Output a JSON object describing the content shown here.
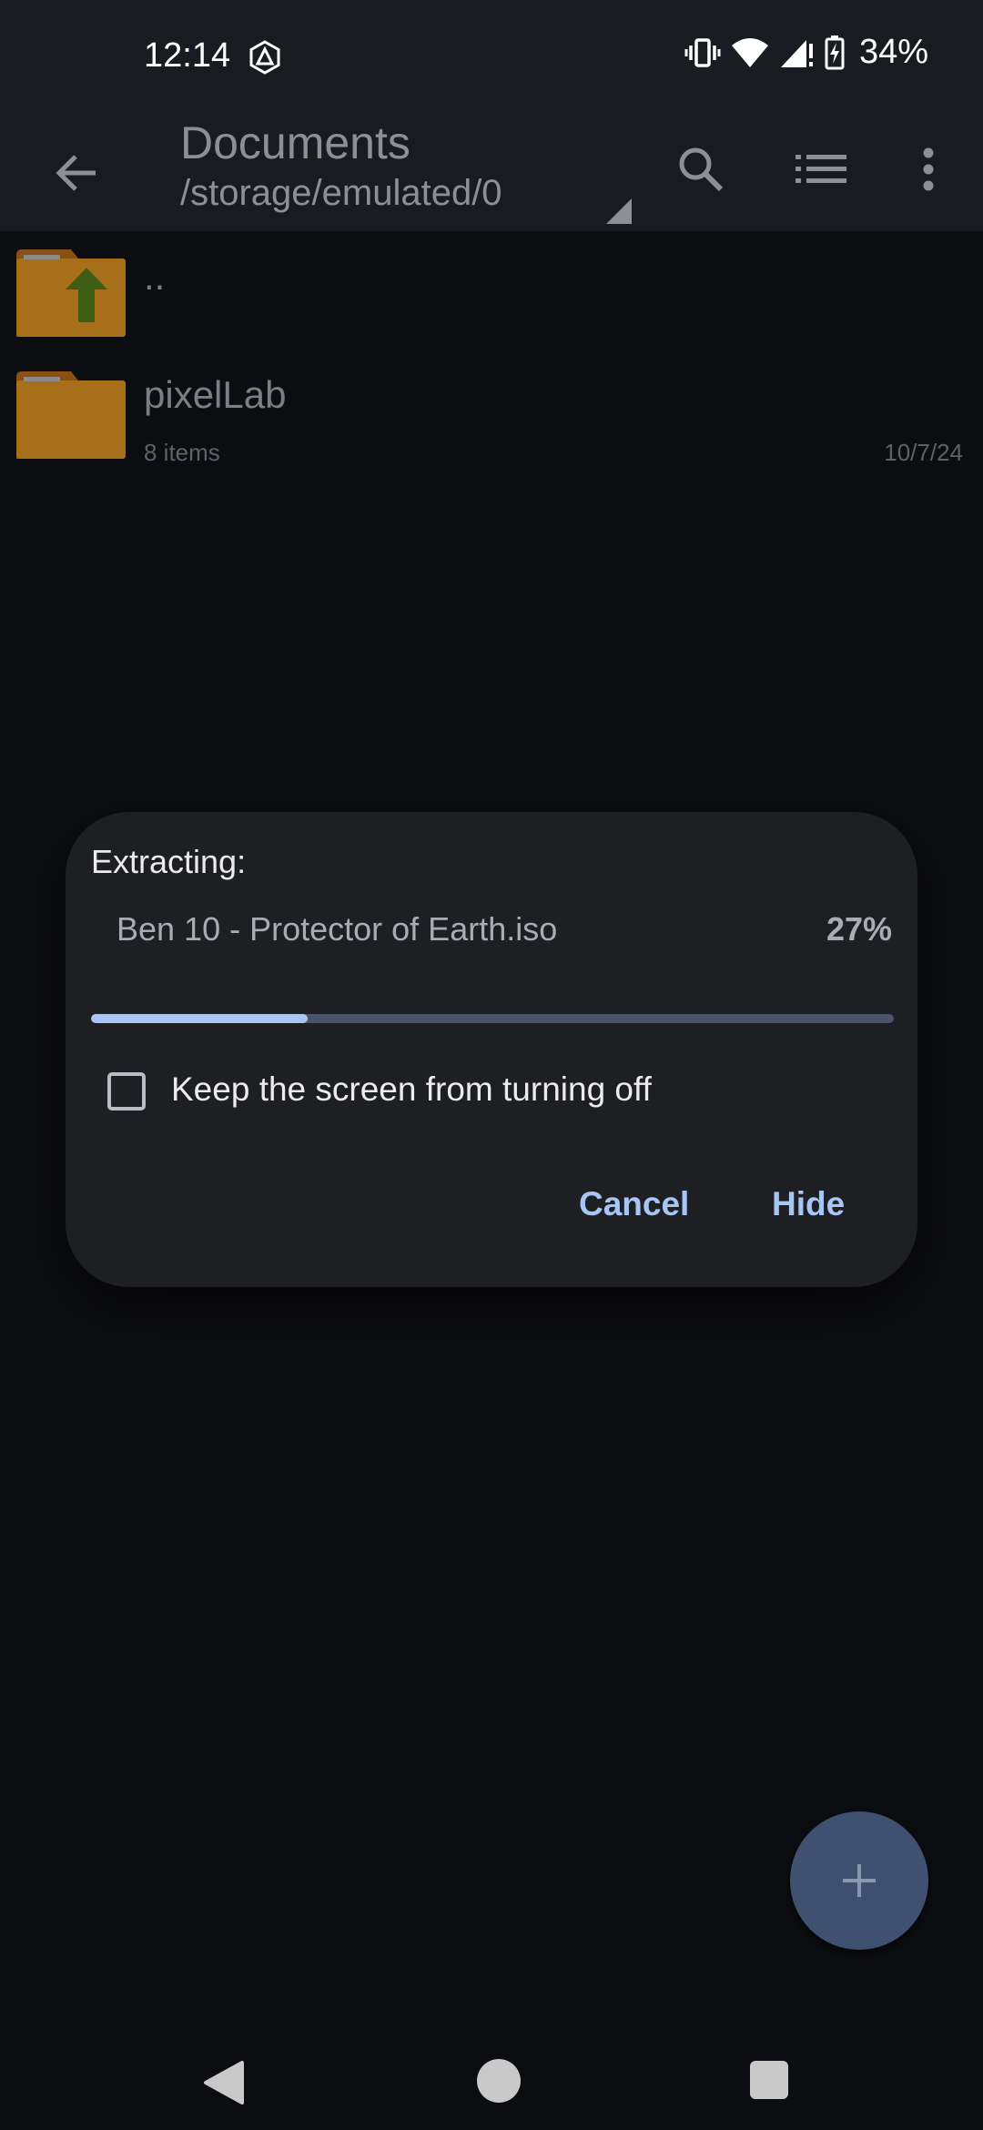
{
  "status_bar": {
    "time": "12:14",
    "battery": "34%",
    "icons": [
      "notification-app-icon",
      "vibrate-icon",
      "wifi-icon",
      "signal-icon",
      "battery-charging-icon"
    ]
  },
  "app_bar": {
    "title": "Documents",
    "path": "/storage/emulated/0",
    "icons": [
      "back-arrow-icon",
      "dropdown-triangle-icon",
      "search-icon",
      "list-view-icon",
      "more-vert-icon"
    ]
  },
  "files": [
    {
      "name": "..",
      "meta": "",
      "date": "",
      "icon": "folder-up-icon"
    },
    {
      "name": "pixelLab",
      "meta": "8 items",
      "date": "10/7/24",
      "icon": "folder-icon"
    }
  ],
  "dialog": {
    "title": "Extracting:",
    "file": "Ben 10 - Protector of Earth.iso",
    "percent_label": "27%",
    "progress": 0.27,
    "checkbox_label": "Keep the screen from turning off",
    "checkbox_checked": false,
    "cancel_label": "Cancel",
    "hide_label": "Hide"
  },
  "fab": {
    "icon": "plus-icon"
  },
  "nav": {
    "icons": [
      "nav-back-icon",
      "nav-home-icon",
      "nav-recents-icon"
    ]
  },
  "colors": {
    "accent": "#a8c6f5",
    "background": "#0c0d10",
    "app_bar": "#181b22",
    "dialog": "#1d1f23",
    "folder": "#a86f1a"
  }
}
